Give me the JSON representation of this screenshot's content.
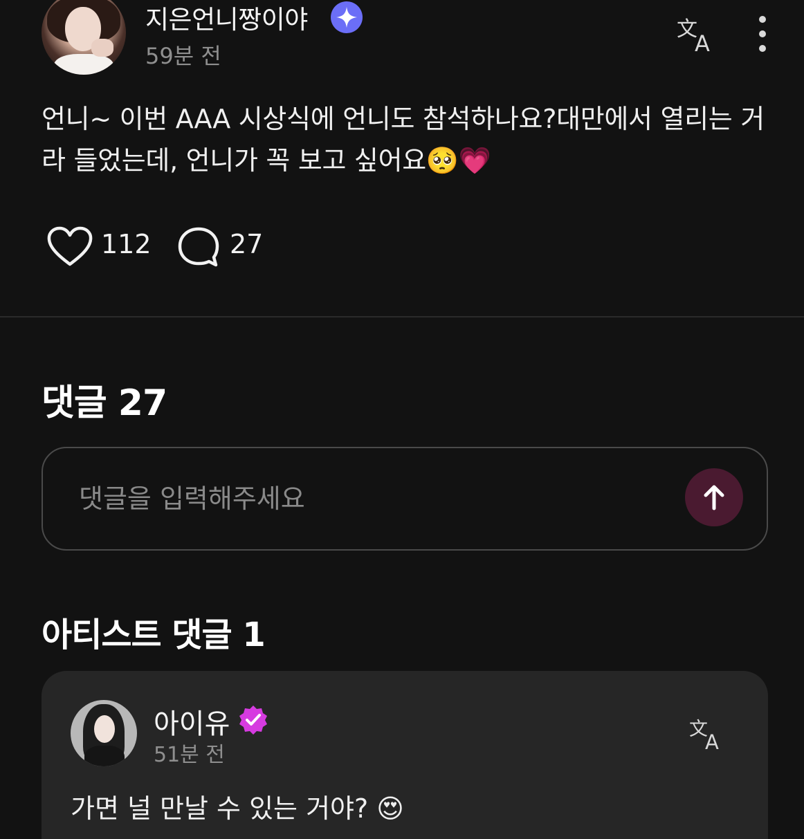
{
  "post": {
    "username": "지은언니짱이야",
    "badge_icon": "sparkle-badge-icon",
    "time": "59분 전",
    "body": "언니~ 이번 AAA 시상식에 언니도 참석하나요?대만에서 열리는 거라 들었는데, 언니가 꼭 보고 싶어요🥺💗",
    "likes": "112",
    "comments": "27"
  },
  "comments_section": {
    "title": "댓글 27",
    "input_placeholder": "댓글을 입력해주세요"
  },
  "artist_section": {
    "title": "아티스트 댓글 1",
    "comment": {
      "name": "아이유",
      "time": "51분 전",
      "text": "가면 널 만날 수 있는 거야? 😍"
    }
  },
  "colors": {
    "background": "#121212",
    "card": "#262626",
    "send_button": "#4a1a30",
    "badge_blue": "#6b6ef7",
    "badge_verified": "#d63be0"
  }
}
